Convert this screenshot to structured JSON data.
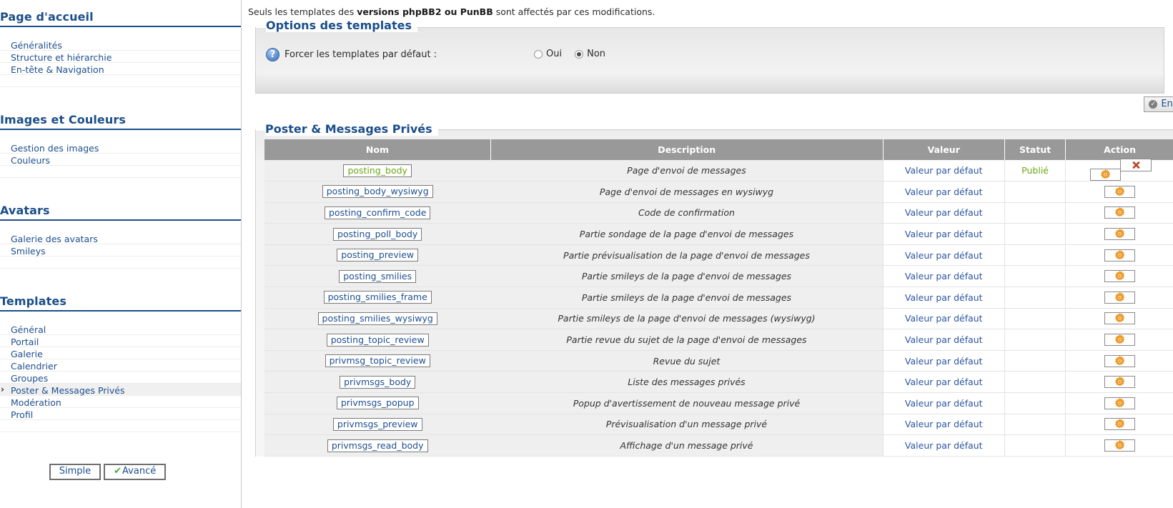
{
  "sidebar": {
    "sections": [
      {
        "title": "Page d'accueil",
        "items": [
          {
            "label": "Généralités",
            "active": false
          },
          {
            "label": "Structure et hiérarchie",
            "active": false
          },
          {
            "label": "En-tête & Navigation",
            "active": false
          }
        ]
      },
      {
        "title": "Images et Couleurs",
        "items": [
          {
            "label": "Gestion des images",
            "active": false
          },
          {
            "label": "Couleurs",
            "active": false
          }
        ]
      },
      {
        "title": "Avatars",
        "items": [
          {
            "label": "Galerie des avatars",
            "active": false
          },
          {
            "label": "Smileys",
            "active": false
          }
        ]
      },
      {
        "title": "Templates",
        "items": [
          {
            "label": "Général",
            "active": false
          },
          {
            "label": "Portail",
            "active": false
          },
          {
            "label": "Galerie",
            "active": false
          },
          {
            "label": "Calendrier",
            "active": false
          },
          {
            "label": "Groupes",
            "active": false
          },
          {
            "label": "Poster & Messages Privés",
            "active": true
          },
          {
            "label": "Modération",
            "active": false
          },
          {
            "label": "Profil",
            "active": false
          }
        ]
      }
    ],
    "mode_buttons": {
      "simple": "Simple",
      "advanced": "Avancé",
      "check_glyph": "✔"
    }
  },
  "main": {
    "notice": {
      "before": "Seuls les templates des ",
      "bold": "versions phpBB2 ou PunBB",
      "after": " sont affectés par ces modifications."
    },
    "options_panel": {
      "legend": "Options des templates",
      "help_glyph": "?",
      "setting_label": "Forcer les templates par défaut :",
      "radios": [
        {
          "label": "Oui",
          "checked": false
        },
        {
          "label": "Non",
          "checked": true
        }
      ]
    },
    "save_button": {
      "label": "Enregistrer",
      "glyph": "✓"
    },
    "table_panel": {
      "legend": "Poster & Messages Privés",
      "columns": [
        "Nom",
        "Description",
        "Valeur",
        "Statut",
        "Action"
      ],
      "default_value_label": "Valeur par défaut",
      "rows": [
        {
          "name": "posting_body",
          "description": "Page d'envoi de messages",
          "value": "Valeur par défaut",
          "status": "Publié",
          "published": true,
          "deletable": true
        },
        {
          "name": "posting_body_wysiwyg",
          "description": "Page d'envoi de messages en wysiwyg",
          "value": "Valeur par défaut",
          "status": "",
          "published": false,
          "deletable": false
        },
        {
          "name": "posting_confirm_code",
          "description": "Code de confirmation",
          "value": "Valeur par défaut",
          "status": "",
          "published": false,
          "deletable": false
        },
        {
          "name": "posting_poll_body",
          "description": "Partie sondage de la page d'envoi de messages",
          "value": "Valeur par défaut",
          "status": "",
          "published": false,
          "deletable": false
        },
        {
          "name": "posting_preview",
          "description": "Partie prévisualisation de la page d'envoi de messages",
          "value": "Valeur par défaut",
          "status": "",
          "published": false,
          "deletable": false
        },
        {
          "name": "posting_smilies",
          "description": "Partie smileys de la page d'envoi de messages",
          "value": "Valeur par défaut",
          "status": "",
          "published": false,
          "deletable": false
        },
        {
          "name": "posting_smilies_frame",
          "description": "Partie smileys de la page d'envoi de messages",
          "value": "Valeur par défaut",
          "status": "",
          "published": false,
          "deletable": false
        },
        {
          "name": "posting_smilies_wysiwyg",
          "description": "Partie smileys de la page d'envoi de messages (wysiwyg)",
          "value": "Valeur par défaut",
          "status": "",
          "published": false,
          "deletable": false
        },
        {
          "name": "posting_topic_review",
          "description": "Partie revue du sujet de la page d'envoi de messages",
          "value": "Valeur par défaut",
          "status": "",
          "published": false,
          "deletable": false
        },
        {
          "name": "privmsg_topic_review",
          "description": "Revue du sujet",
          "value": "Valeur par défaut",
          "status": "",
          "published": false,
          "deletable": false
        },
        {
          "name": "privmsgs_body",
          "description": "Liste des messages privés",
          "value": "Valeur par défaut",
          "status": "",
          "published": false,
          "deletable": false
        },
        {
          "name": "privmsgs_popup",
          "description": "Popup d'avertissement de nouveau message privé",
          "value": "Valeur par défaut",
          "status": "",
          "published": false,
          "deletable": false
        },
        {
          "name": "privmsgs_preview",
          "description": "Prévisualisation d'un message privé",
          "value": "Valeur par défaut",
          "status": "",
          "published": false,
          "deletable": false
        },
        {
          "name": "privmsgs_read_body",
          "description": "Affichage d'un message privé",
          "value": "Valeur par défaut",
          "status": "",
          "published": false,
          "deletable": false
        }
      ]
    }
  },
  "colors": {
    "heading_blue": "#1b4e8a",
    "link_blue": "#1e4f8f",
    "published_green": "#6aa818",
    "table_header_grey": "#999999",
    "row_grey": "#efefef"
  }
}
